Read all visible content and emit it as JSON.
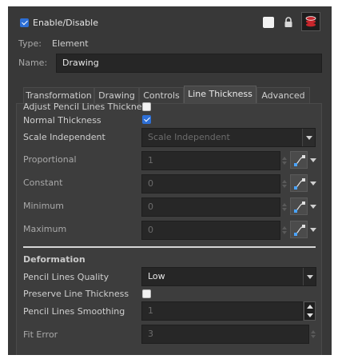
{
  "header": {
    "enable_label": "Enable/Disable",
    "enabled": true,
    "type_label": "Type:",
    "type_value": "Element",
    "name_label": "Name:",
    "name_value": "Drawing"
  },
  "tabs": [
    {
      "label": "Transformation",
      "active": false
    },
    {
      "label": "Drawing",
      "active": false
    },
    {
      "label": "Controls",
      "active": false
    },
    {
      "label": "Line Thickness",
      "active": true
    },
    {
      "label": "Advanced",
      "active": false
    }
  ],
  "line_thickness": {
    "adjust_label": "Adjust Pencil Lines Thickness",
    "adjust_checked": false,
    "normal_label": "Normal Thickness",
    "normal_checked": true,
    "scale_label": "Scale Independent",
    "scale_value": "Scale Independent",
    "proportional": {
      "label": "Proportional",
      "value": "1"
    },
    "constant": {
      "label": "Constant",
      "value": "0"
    },
    "minimum": {
      "label": "Minimum",
      "value": "0"
    },
    "maximum": {
      "label": "Maximum",
      "value": "0"
    }
  },
  "deformation": {
    "title": "Deformation",
    "quality_label": "Pencil Lines Quality",
    "quality_value": "Low",
    "preserve_label": "Preserve Line Thickness",
    "preserve_checked": false,
    "smoothing_label": "Pencil Lines Smoothing",
    "smoothing_value": "1",
    "fit_error_label": "Fit Error",
    "fit_error_value": "3"
  },
  "icons": [
    "checkbox-icon",
    "white-square-icon",
    "lock-icon",
    "layer-color-icon",
    "function-curve-icon",
    "chevron-down-icon"
  ],
  "colors": {
    "panel": "#383838",
    "accent": "#2d6fd6",
    "layer_icon": "#c8262c"
  }
}
